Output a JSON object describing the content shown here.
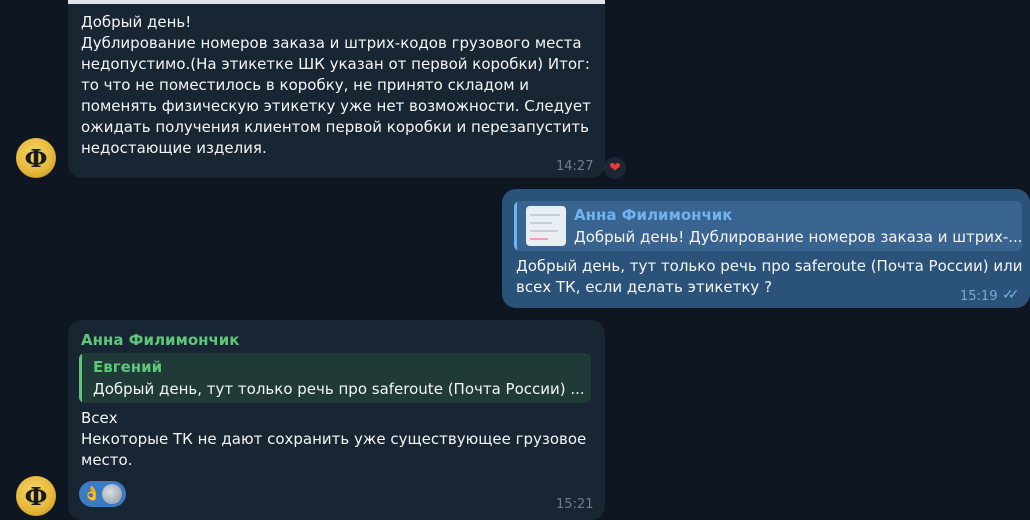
{
  "messages": [
    {
      "lines": [
        "Добрый день!",
        "Дублирование номеров заказа и штрих-кодов грузового места",
        "недопустимо.(На этикетке ШК указан от первой коробки) Итог:",
        "то что не поместилось в коробку, не принято складом и",
        "поменять физическую этикетку уже нет возможности. Следует",
        "ожидать получения клиентом первой коробки и перезапустить",
        "недостающие изделия."
      ],
      "time": "14:27",
      "reaction": "❤"
    },
    {
      "reply": {
        "author": "Анна Филимончик",
        "text": "Добрый день! Дублирование номеров заказа и штрих-..."
      },
      "lines": [
        "Добрый день, тут только речь про saferoute (Почта России) или",
        "всех ТК, если делать этикетку ?"
      ],
      "time": "15:19",
      "status": "read"
    },
    {
      "sender": "Анна Филимончик",
      "reply": {
        "author": "Евгений",
        "text": "Добрый день, тут только речь про saferoute (Почта России) ..."
      },
      "lines": [
        "Всех",
        "Некоторые ТК не дают сохранить уже существующее грузовое",
        "место."
      ],
      "time": "15:21",
      "reaction": "👌"
    }
  ],
  "avatar_letter": "Ф",
  "icons": {
    "heart": "heart-icon",
    "read": "double-check-icon",
    "ok_hand": "ok-hand-icon"
  },
  "colors": {
    "background": "#0e1621",
    "incoming": "#182533",
    "outgoing": "#2b5278",
    "sender_green": "#5fc67a",
    "reply_blue": "#6fb3ef"
  }
}
